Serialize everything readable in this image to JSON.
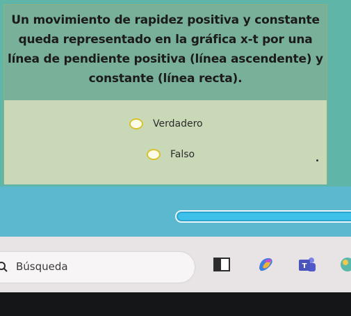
{
  "question": {
    "text": "Un movimiento de rapidez positiva y constante queda representado en la gráfica x-t por una línea de pendiente positiva (línea ascendente) y constante (línea recta).",
    "options": [
      {
        "label": "Verdadero"
      },
      {
        "label": "Falso"
      }
    ]
  },
  "progress": {
    "percent": 100
  },
  "taskbar": {
    "search_label": "Búsqueda",
    "icons": [
      "task-view-icon",
      "copilot-icon",
      "teams-icon",
      "weather-icon"
    ]
  },
  "colors": {
    "header": "#79b09a",
    "card": "#c9d9b8",
    "page_bg": "#5fb5a8",
    "progress_bg": "#5cb8cf",
    "radio_border": "#d7c22b",
    "taskbar": "#e8e4e6"
  }
}
